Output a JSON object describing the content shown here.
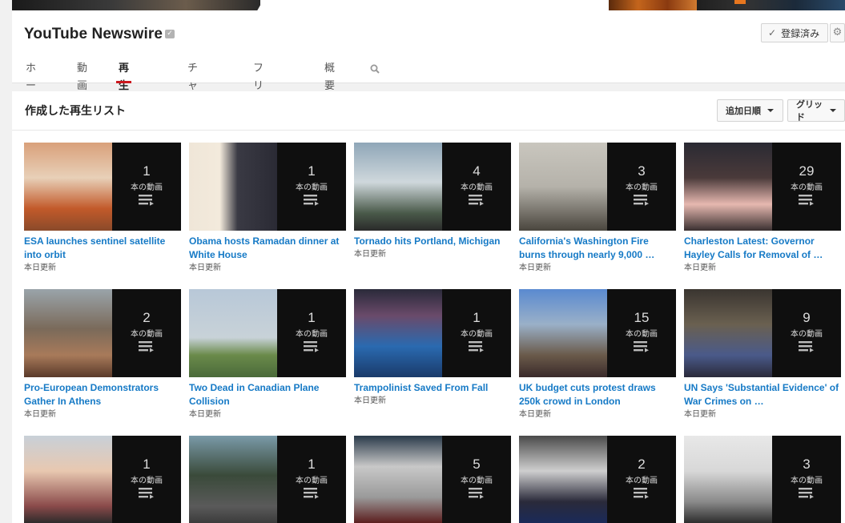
{
  "channel": {
    "title": "YouTube Newswire",
    "subscribe_label": "登録済み"
  },
  "tabs": [
    "ホーム",
    "動画",
    "再生リスト",
    "チャンネル",
    "フリートーク",
    "概要"
  ],
  "section": {
    "title": "作成した再生リスト",
    "sort_label": "追加日順",
    "view_label": "グリッド"
  },
  "count_suffix": "本の動画",
  "playlists": [
    {
      "title": "ESA launches sentinel satellite into orbit",
      "count": "1",
      "updated": "本日更新"
    },
    {
      "title": "Obama hosts Ramadan dinner at White House",
      "count": "1",
      "updated": "本日更新"
    },
    {
      "title": "Tornado hits Portland, Michigan",
      "count": "4",
      "updated": "本日更新"
    },
    {
      "title": "California's Washington Fire burns through nearly 9,000 …",
      "count": "3",
      "updated": "本日更新"
    },
    {
      "title": "Charleston Latest: Governor Hayley Calls for Removal of …",
      "count": "29",
      "updated": "本日更新"
    },
    {
      "title": "Pro-European Demonstrators Gather In Athens",
      "count": "2",
      "updated": "本日更新"
    },
    {
      "title": "Two Dead in Canadian Plane Collision",
      "count": "1",
      "updated": "本日更新"
    },
    {
      "title": "Trampolinist Saved From Fall",
      "count": "1",
      "updated": "本日更新"
    },
    {
      "title": "UK budget cuts protest draws 250k crowd in London",
      "count": "15",
      "updated": "本日更新"
    },
    {
      "title": "UN Says 'Substantial Evidence' of War Crimes on …",
      "count": "9",
      "updated": "本日更新"
    },
    {
      "title": "",
      "count": "1",
      "updated": ""
    },
    {
      "title": "",
      "count": "1",
      "updated": ""
    },
    {
      "title": "",
      "count": "5",
      "updated": ""
    },
    {
      "title": "",
      "count": "2",
      "updated": ""
    },
    {
      "title": "",
      "count": "3",
      "updated": ""
    }
  ]
}
